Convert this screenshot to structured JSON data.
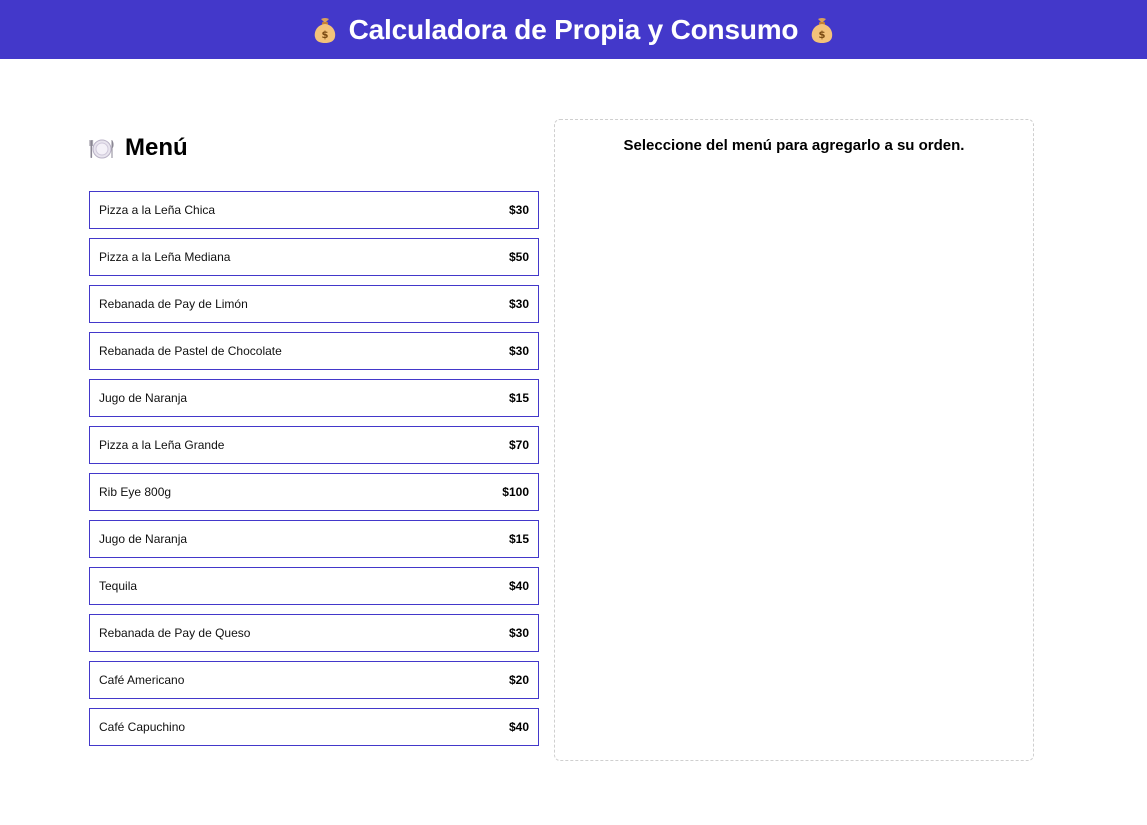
{
  "header": {
    "title": "Calculadora de Propia y Consumo",
    "icon_left": "money-bag-icon",
    "icon_right": "money-bag-icon",
    "background": "#4338ca"
  },
  "menu": {
    "icon": "plate-cutlery-icon",
    "title": "Menú",
    "items": [
      {
        "name": "Pizza a la Leña Chica",
        "price": "$30"
      },
      {
        "name": "Pizza a la Leña Mediana",
        "price": "$50"
      },
      {
        "name": "Rebanada de Pay de Limón",
        "price": "$30"
      },
      {
        "name": "Rebanada de Pastel de Chocolate",
        "price": "$30"
      },
      {
        "name": "Jugo de Naranja",
        "price": "$15"
      },
      {
        "name": "Pizza a la Leña Grande",
        "price": "$70"
      },
      {
        "name": "Rib Eye 800g",
        "price": "$100"
      },
      {
        "name": "Jugo de Naranja",
        "price": "$15"
      },
      {
        "name": "Tequila",
        "price": "$40"
      },
      {
        "name": "Rebanada de Pay de Queso",
        "price": "$30"
      },
      {
        "name": "Café Americano",
        "price": "$20"
      },
      {
        "name": "Café Capuchino",
        "price": "$40"
      }
    ]
  },
  "order": {
    "empty_message": "Seleccione del menú para agregarlo a su orden."
  }
}
